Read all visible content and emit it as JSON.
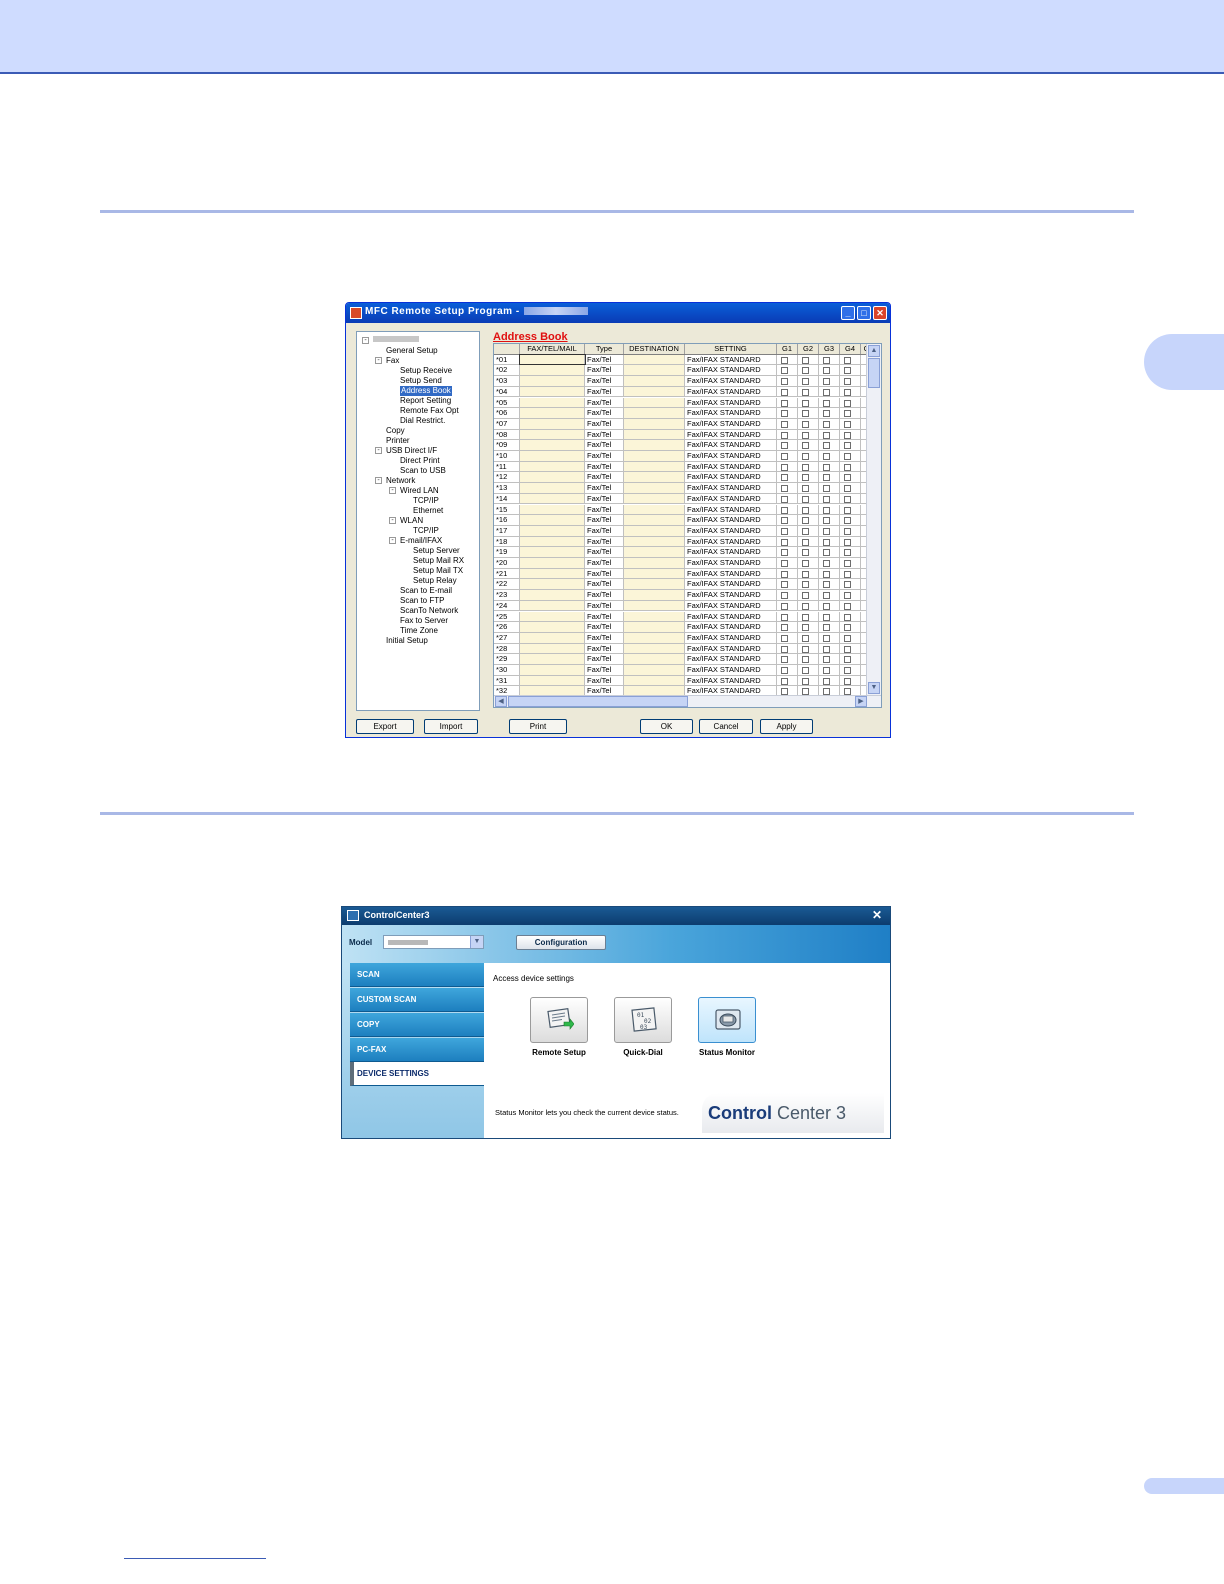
{
  "remote_setup": {
    "window_title": "MFC Remote Setup Program -",
    "minimize_glyph": "_",
    "maximize_glyph": "□",
    "close_glyph": "✕",
    "tree": [
      {
        "label": "General Setup",
        "level": 2
      },
      {
        "label": "Fax",
        "level": 2,
        "expander": "-"
      },
      {
        "label": "Setup Receive",
        "level": 3
      },
      {
        "label": "Setup Send",
        "level": 3
      },
      {
        "label": "Address Book",
        "level": 3,
        "selected": true
      },
      {
        "label": "Report Setting",
        "level": 3
      },
      {
        "label": "Remote Fax Opt",
        "level": 3
      },
      {
        "label": "Dial Restrict.",
        "level": 3
      },
      {
        "label": "Copy",
        "level": 2
      },
      {
        "label": "Printer",
        "level": 2
      },
      {
        "label": "USB Direct I/F",
        "level": 2,
        "expander": "-"
      },
      {
        "label": "Direct Print",
        "level": 3
      },
      {
        "label": "Scan to USB",
        "level": 3
      },
      {
        "label": "Network",
        "level": 2,
        "expander": "-"
      },
      {
        "label": "Wired LAN",
        "level": 3,
        "expander": "-"
      },
      {
        "label": "TCP/IP",
        "level": 4
      },
      {
        "label": "Ethernet",
        "level": 4
      },
      {
        "label": "WLAN",
        "level": 3,
        "expander": "-"
      },
      {
        "label": "TCP/IP",
        "level": 4
      },
      {
        "label": "E-mail/IFAX",
        "level": 3,
        "expander": "-"
      },
      {
        "label": "Setup Server",
        "level": 4
      },
      {
        "label": "Setup Mail RX",
        "level": 4
      },
      {
        "label": "Setup Mail TX",
        "level": 4
      },
      {
        "label": "Setup Relay",
        "level": 4
      },
      {
        "label": "Scan to E-mail",
        "level": 3
      },
      {
        "label": "Scan to FTP",
        "level": 3
      },
      {
        "label": "ScanTo Network",
        "level": 3
      },
      {
        "label": "Fax to Server",
        "level": 3
      },
      {
        "label": "Time Zone",
        "level": 3
      },
      {
        "label": "Initial Setup",
        "level": 2
      }
    ],
    "section_title": "Address Book",
    "columns": [
      "",
      "FAX/TEL/MAIL",
      "Type",
      "DESTINATION",
      "SETTING",
      "G1",
      "G2",
      "G3",
      "G4",
      "G"
    ],
    "rows": [
      {
        "id": "*01",
        "type": "Fax/Tel",
        "setting": "Fax/IFAX STANDARD"
      },
      {
        "id": "*02",
        "type": "Fax/Tel",
        "setting": "Fax/IFAX STANDARD"
      },
      {
        "id": "*03",
        "type": "Fax/Tel",
        "setting": "Fax/IFAX STANDARD"
      },
      {
        "id": "*04",
        "type": "Fax/Tel",
        "setting": "Fax/IFAX STANDARD"
      },
      {
        "id": "*05",
        "type": "Fax/Tel",
        "setting": "Fax/IFAX STANDARD"
      },
      {
        "id": "*06",
        "type": "Fax/Tel",
        "setting": "Fax/IFAX STANDARD"
      },
      {
        "id": "*07",
        "type": "Fax/Tel",
        "setting": "Fax/IFAX STANDARD"
      },
      {
        "id": "*08",
        "type": "Fax/Tel",
        "setting": "Fax/IFAX STANDARD"
      },
      {
        "id": "*09",
        "type": "Fax/Tel",
        "setting": "Fax/IFAX STANDARD"
      },
      {
        "id": "*10",
        "type": "Fax/Tel",
        "setting": "Fax/IFAX STANDARD"
      },
      {
        "id": "*11",
        "type": "Fax/Tel",
        "setting": "Fax/IFAX STANDARD"
      },
      {
        "id": "*12",
        "type": "Fax/Tel",
        "setting": "Fax/IFAX STANDARD"
      },
      {
        "id": "*13",
        "type": "Fax/Tel",
        "setting": "Fax/IFAX STANDARD"
      },
      {
        "id": "*14",
        "type": "Fax/Tel",
        "setting": "Fax/IFAX STANDARD"
      },
      {
        "id": "*15",
        "type": "Fax/Tel",
        "setting": "Fax/IFAX STANDARD"
      },
      {
        "id": "*16",
        "type": "Fax/Tel",
        "setting": "Fax/IFAX STANDARD"
      },
      {
        "id": "*17",
        "type": "Fax/Tel",
        "setting": "Fax/IFAX STANDARD"
      },
      {
        "id": "*18",
        "type": "Fax/Tel",
        "setting": "Fax/IFAX STANDARD"
      },
      {
        "id": "*19",
        "type": "Fax/Tel",
        "setting": "Fax/IFAX STANDARD"
      },
      {
        "id": "*20",
        "type": "Fax/Tel",
        "setting": "Fax/IFAX STANDARD"
      },
      {
        "id": "*21",
        "type": "Fax/Tel",
        "setting": "Fax/IFAX STANDARD"
      },
      {
        "id": "*22",
        "type": "Fax/Tel",
        "setting": "Fax/IFAX STANDARD"
      },
      {
        "id": "*23",
        "type": "Fax/Tel",
        "setting": "Fax/IFAX STANDARD"
      },
      {
        "id": "*24",
        "type": "Fax/Tel",
        "setting": "Fax/IFAX STANDARD"
      },
      {
        "id": "*25",
        "type": "Fax/Tel",
        "setting": "Fax/IFAX STANDARD"
      },
      {
        "id": "*26",
        "type": "Fax/Tel",
        "setting": "Fax/IFAX STANDARD"
      },
      {
        "id": "*27",
        "type": "Fax/Tel",
        "setting": "Fax/IFAX STANDARD"
      },
      {
        "id": "*28",
        "type": "Fax/Tel",
        "setting": "Fax/IFAX STANDARD"
      },
      {
        "id": "*29",
        "type": "Fax/Tel",
        "setting": "Fax/IFAX STANDARD"
      },
      {
        "id": "*30",
        "type": "Fax/Tel",
        "setting": "Fax/IFAX STANDARD"
      },
      {
        "id": "*31",
        "type": "Fax/Tel",
        "setting": "Fax/IFAX STANDARD"
      },
      {
        "id": "*32",
        "type": "Fax/Tel",
        "setting": "Fax/IFAX STANDARD"
      }
    ],
    "scroll_up_glyph": "▲",
    "scroll_down_glyph": "▼",
    "scroll_left_glyph": "◀",
    "scroll_right_glyph": "▶",
    "buttons": {
      "export": "Export",
      "import": "Import",
      "print": "Print",
      "ok": "OK",
      "cancel": "Cancel",
      "apply": "Apply"
    }
  },
  "control_center": {
    "window_title": "ControlCenter3",
    "close_glyph": "✕",
    "model_label": "Model",
    "dropdown_glyph": "▼",
    "configuration_label": "Configuration",
    "nav": [
      {
        "label": "SCAN"
      },
      {
        "label": "CUSTOM SCAN"
      },
      {
        "label": "COPY"
      },
      {
        "label": "PC-FAX"
      },
      {
        "label": "DEVICE SETTINGS",
        "active": true
      }
    ],
    "access_text": "Access device settings",
    "icon_buttons": [
      {
        "label": "Remote Setup",
        "icon": "remote-setup-icon"
      },
      {
        "label": "Quick-Dial",
        "icon": "quick-dial-icon"
      },
      {
        "label": "Status Monitor",
        "icon": "status-monitor-icon",
        "active": true
      }
    ],
    "status_text": "Status Monitor lets you check the current device status.",
    "brand": {
      "bold": "Control",
      "light": " Center 3"
    }
  },
  "colors": {
    "accent": "#3b5bb5",
    "band": "#cfdcff",
    "xp_title": "#0a5fd8",
    "cc_blue": "#1d7fbf",
    "address_book_red": "#e01010"
  }
}
